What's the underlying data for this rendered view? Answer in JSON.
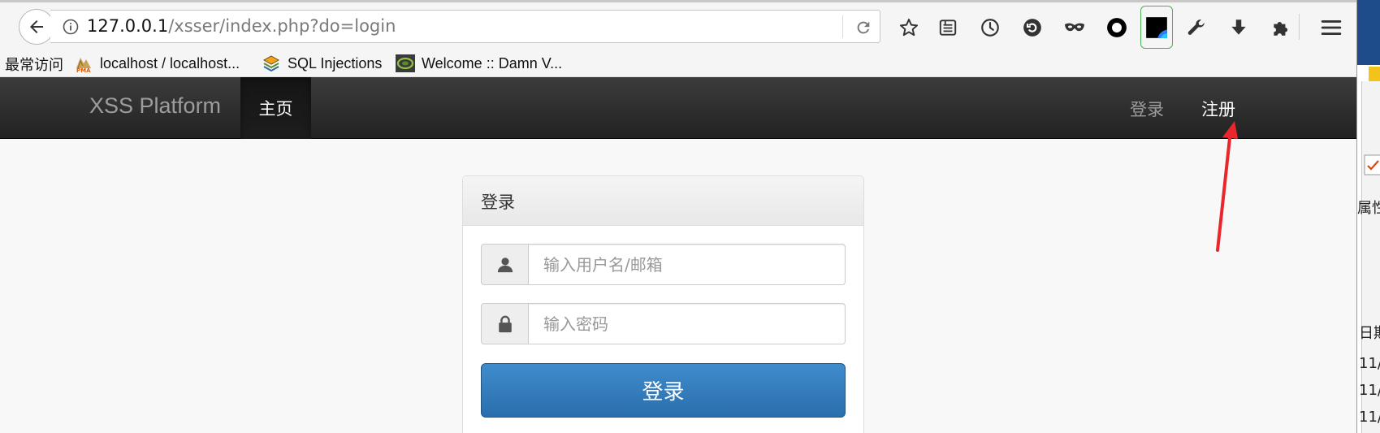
{
  "browser": {
    "url": {
      "host": "127.0.0.1",
      "path": "/xsser/index.php?do=login"
    },
    "toolbar_icons": [
      "star-icon",
      "reading-list-icon",
      "history-icon",
      "sync-icon",
      "mask-icon",
      "circle-icon",
      "screen-icon",
      "wrench-icon",
      "download-icon",
      "puzzle-icon",
      "menu-icon"
    ],
    "bookmarks": [
      {
        "label": "最常访问",
        "icon": "none"
      },
      {
        "label": "localhost / localhost...",
        "icon": "phpmyadmin-icon"
      },
      {
        "label": "SQL Injections",
        "icon": "layers-icon"
      },
      {
        "label": "Welcome :: Damn V...",
        "icon": "dvwa-icon"
      }
    ]
  },
  "site": {
    "brand": "XSS Platform",
    "nav": {
      "home": "主页",
      "login": "登录",
      "register": "注册"
    }
  },
  "login_panel": {
    "title": "登录",
    "username_placeholder": "输入用户名/邮箱",
    "password_placeholder": "输入密码",
    "submit_label": "登录"
  },
  "side_window": {
    "texts": [
      "属性",
      "日期",
      "11/",
      "11/",
      "11/"
    ]
  },
  "colors": {
    "navbar": "#222222",
    "primary_button": "#337ab7",
    "annotation": "#e8262b"
  }
}
